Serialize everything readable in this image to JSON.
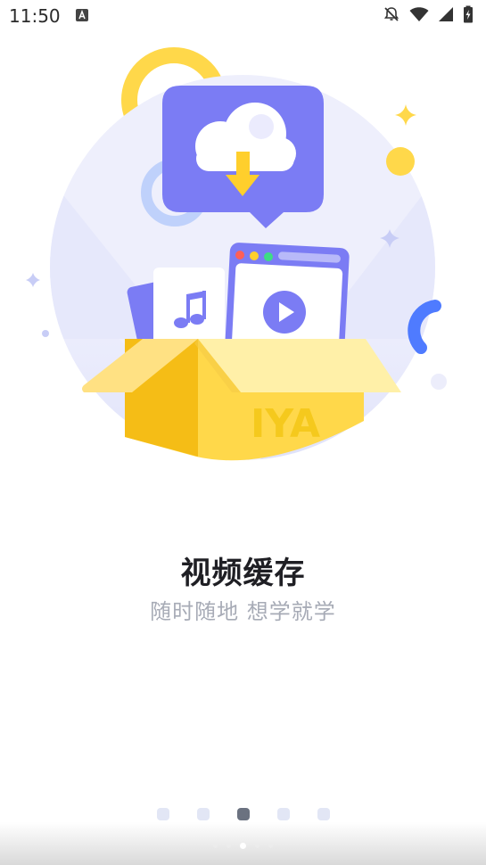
{
  "status_bar": {
    "time": "11:50",
    "icons": [
      "a-notification-icon",
      "mute-icon",
      "wifi-icon",
      "signal-icon",
      "battery-charging-icon"
    ]
  },
  "illustration": {
    "box_text": "IYA",
    "colors": {
      "circle_bg": "#eeeffc",
      "card": "#7b7cf4",
      "box_yellow": "#ffd84a",
      "box_dark": "#f5bd16",
      "accent_blue": "#4f7bff"
    }
  },
  "onboarding": {
    "title": "视频缓存",
    "subtitle": "随时随地 想学就学"
  },
  "pagination": {
    "total": 5,
    "active_index": 2
  }
}
